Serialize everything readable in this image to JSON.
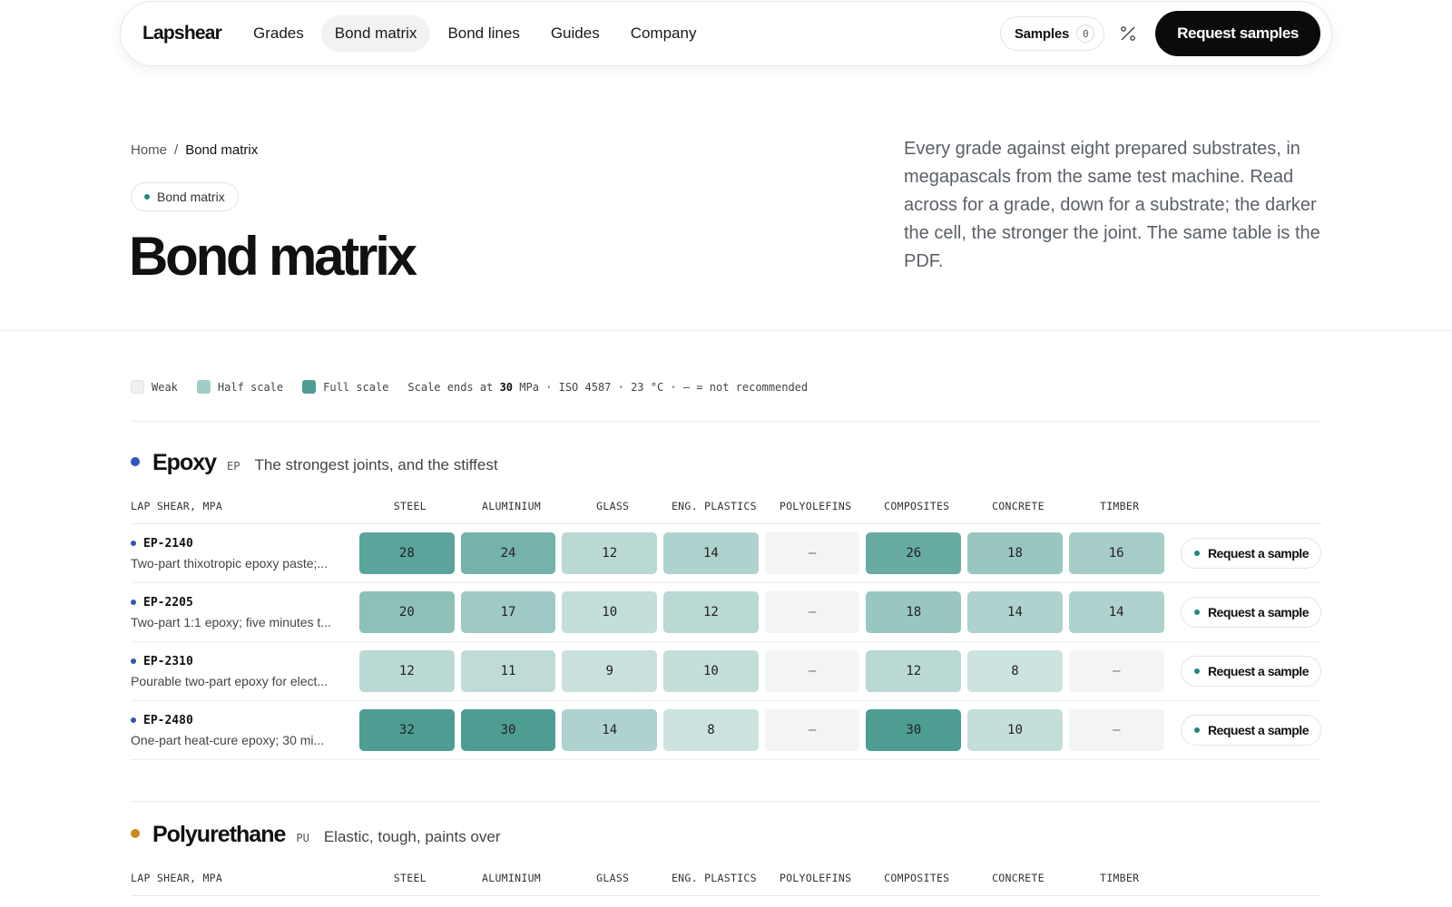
{
  "nav": {
    "logo": "Lapshear",
    "links": [
      {
        "label": "Grades",
        "active": false
      },
      {
        "label": "Bond matrix",
        "active": true
      },
      {
        "label": "Bond lines",
        "active": false
      },
      {
        "label": "Guides",
        "active": false
      },
      {
        "label": "Company",
        "active": false
      }
    ],
    "samples_label": "Samples",
    "samples_count": "0",
    "cta": "Request samples"
  },
  "breadcrumb": {
    "home": "Home",
    "sep": "/",
    "current": "Bond matrix"
  },
  "pill": "Bond matrix",
  "title": "Bond matrix",
  "intro": "Every grade against eight prepared substrates, in megapascals from the same test machine. Read across for a grade, down for a substrate; the darker the cell, the stronger the joint. The same table is the PDF.",
  "legend": {
    "weak": "Weak",
    "half": "Half scale",
    "full": "Full scale",
    "scale_prefix": "Scale ends at",
    "scale_value": "30",
    "scale_suffix": "MPa · ISO 4587 · 23 °C · — = not recommended",
    "colors": {
      "weak": "#eef0f1",
      "half": "#9fcdc6",
      "full": "#4e9d93"
    }
  },
  "scale_max": 30,
  "substrates": [
    "STEEL",
    "ALUMINIUM",
    "GLASS",
    "ENG. PLASTICS",
    "POLYOLEFINS",
    "COMPOSITES",
    "CONCRETE",
    "TIMBER"
  ],
  "lap_label": "LAP SHEAR, MPA",
  "request_label": "Request a sample",
  "families": [
    {
      "name": "Epoxy",
      "code": "EP",
      "tagline": "The strongest joints, and the stiffest",
      "color": "#2f55b5",
      "grades": [
        {
          "code": "EP-2140",
          "desc": "Two-part thixotropic epoxy paste;...",
          "values": [
            "28",
            "24",
            "12",
            "14",
            "—",
            "26",
            "18",
            "16"
          ]
        },
        {
          "code": "EP-2205",
          "desc": "Two-part 1:1 epoxy; five minutes t...",
          "values": [
            "20",
            "17",
            "10",
            "12",
            "—",
            "18",
            "14",
            "14"
          ]
        },
        {
          "code": "EP-2310",
          "desc": "Pourable two-part epoxy for elect...",
          "values": [
            "12",
            "11",
            "9",
            "10",
            "—",
            "12",
            "8",
            "—"
          ]
        },
        {
          "code": "EP-2480",
          "desc": "One-part heat-cure epoxy; 30 mi...",
          "values": [
            "32",
            "30",
            "14",
            "8",
            "—",
            "30",
            "10",
            "—"
          ]
        }
      ]
    },
    {
      "name": "Polyurethane",
      "code": "PU",
      "tagline": "Elastic, tough, paints over",
      "color": "#c98a1c",
      "grades": []
    }
  ]
}
